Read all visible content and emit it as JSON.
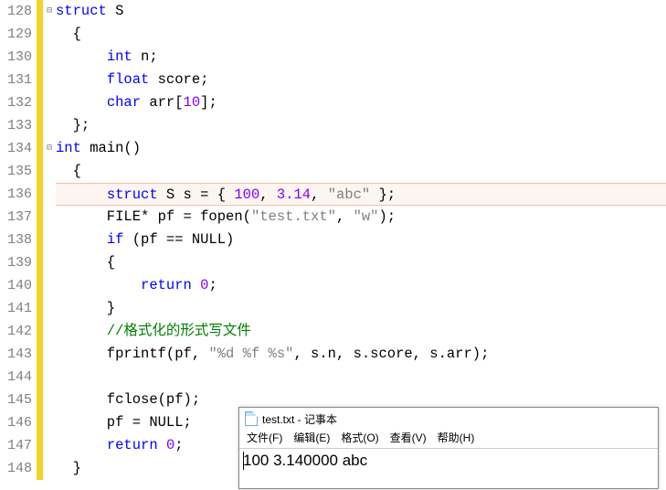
{
  "lines": [
    {
      "n": "128",
      "fold": "⊟",
      "tokens": [
        {
          "c": "kw-blue",
          "t": "struct"
        },
        {
          "c": "txt",
          "t": " S"
        }
      ]
    },
    {
      "n": "129",
      "tokens": [
        {
          "c": "txt",
          "t": "  {"
        }
      ]
    },
    {
      "n": "130",
      "tokens": [
        {
          "c": "txt",
          "t": "      "
        },
        {
          "c": "kw-blue",
          "t": "int"
        },
        {
          "c": "txt",
          "t": " n;"
        }
      ]
    },
    {
      "n": "131",
      "tokens": [
        {
          "c": "txt",
          "t": "      "
        },
        {
          "c": "kw-blue",
          "t": "float"
        },
        {
          "c": "txt",
          "t": " score;"
        }
      ]
    },
    {
      "n": "132",
      "tokens": [
        {
          "c": "txt",
          "t": "      "
        },
        {
          "c": "kw-blue",
          "t": "char"
        },
        {
          "c": "txt",
          "t": " arr["
        },
        {
          "c": "kw-purple",
          "t": "10"
        },
        {
          "c": "txt",
          "t": "];"
        }
      ]
    },
    {
      "n": "133",
      "tokens": [
        {
          "c": "txt",
          "t": "  };"
        }
      ]
    },
    {
      "n": "134",
      "fold": "⊟",
      "tokens": [
        {
          "c": "kw-blue",
          "t": "int"
        },
        {
          "c": "txt",
          "t": " main()"
        }
      ]
    },
    {
      "n": "135",
      "tokens": [
        {
          "c": "txt",
          "t": "  {"
        }
      ]
    },
    {
      "n": "136",
      "hl": true,
      "tokens": [
        {
          "c": "txt",
          "t": "      "
        },
        {
          "c": "kw-blue",
          "t": "struct"
        },
        {
          "c": "txt",
          "t": " S s = { "
        },
        {
          "c": "kw-purple",
          "t": "100"
        },
        {
          "c": "txt",
          "t": ", "
        },
        {
          "c": "kw-purple",
          "t": "3.14"
        },
        {
          "c": "txt",
          "t": ", "
        },
        {
          "c": "str",
          "t": "\"abc\""
        },
        {
          "c": "txt",
          "t": " };"
        }
      ]
    },
    {
      "n": "137",
      "tokens": [
        {
          "c": "txt",
          "t": "      FILE* pf = fopen("
        },
        {
          "c": "str",
          "t": "\"test.txt\""
        },
        {
          "c": "txt",
          "t": ", "
        },
        {
          "c": "str",
          "t": "\"w\""
        },
        {
          "c": "txt",
          "t": ");"
        }
      ]
    },
    {
      "n": "138",
      "tokens": [
        {
          "c": "txt",
          "t": "      "
        },
        {
          "c": "kw-blue",
          "t": "if"
        },
        {
          "c": "txt",
          "t": " (pf == NULL)"
        }
      ]
    },
    {
      "n": "139",
      "tokens": [
        {
          "c": "txt",
          "t": "      {"
        }
      ]
    },
    {
      "n": "140",
      "tokens": [
        {
          "c": "txt",
          "t": "          "
        },
        {
          "c": "kw-blue",
          "t": "return"
        },
        {
          "c": "txt",
          "t": " "
        },
        {
          "c": "kw-purple",
          "t": "0"
        },
        {
          "c": "txt",
          "t": ";"
        }
      ]
    },
    {
      "n": "141",
      "tokens": [
        {
          "c": "txt",
          "t": "      }"
        }
      ]
    },
    {
      "n": "142",
      "tokens": [
        {
          "c": "txt",
          "t": "      "
        },
        {
          "c": "comment",
          "t": "//格式化的形式写文件"
        }
      ]
    },
    {
      "n": "143",
      "tokens": [
        {
          "c": "txt",
          "t": "      fprintf(pf, "
        },
        {
          "c": "str",
          "t": "\"%d %f %s\""
        },
        {
          "c": "txt",
          "t": ", s.n, s.score, s.arr);"
        }
      ]
    },
    {
      "n": "144",
      "tokens": [
        {
          "c": "txt",
          "t": ""
        }
      ]
    },
    {
      "n": "145",
      "tokens": [
        {
          "c": "txt",
          "t": "      fclose(pf);"
        }
      ]
    },
    {
      "n": "146",
      "tokens": [
        {
          "c": "txt",
          "t": "      pf = NULL;"
        }
      ]
    },
    {
      "n": "147",
      "tokens": [
        {
          "c": "txt",
          "t": "      "
        },
        {
          "c": "kw-blue",
          "t": "return"
        },
        {
          "c": "txt",
          "t": " "
        },
        {
          "c": "kw-purple",
          "t": "0"
        },
        {
          "c": "txt",
          "t": ";"
        }
      ]
    },
    {
      "n": "148",
      "tokens": [
        {
          "c": "txt",
          "t": "  }"
        }
      ]
    }
  ],
  "notepad": {
    "title": "test.txt - 记事本",
    "menu": [
      "文件(F)",
      "编辑(E)",
      "格式(O)",
      "查看(V)",
      "帮助(H)"
    ],
    "content": "100 3.140000 abc"
  }
}
